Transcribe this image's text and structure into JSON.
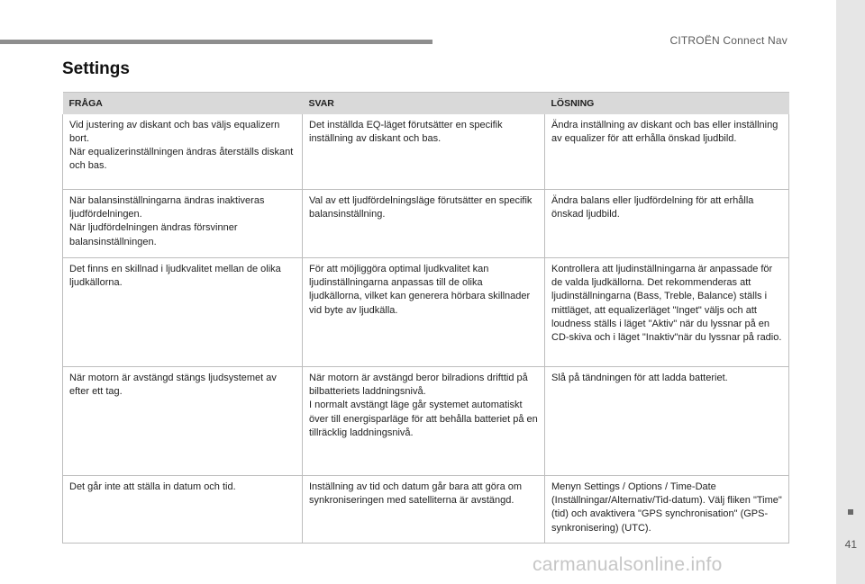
{
  "header": {
    "brand": "CITROËN Connect Nav"
  },
  "title": "Settings",
  "table": {
    "headers": [
      "FRÅGA",
      "SVAR",
      "LÖSNING"
    ],
    "rows": [
      {
        "question": "Vid justering av diskant och bas väljs equalizern bort.\nNär equalizerinställningen ändras återställs diskant och bas.",
        "answer": "Det inställda EQ-läget förutsätter en specifik inställning av diskant och bas.",
        "solution": "Ändra inställning av diskant och bas eller inställning av equalizer för att erhålla önskad ljudbild."
      },
      {
        "question": "När balansinställningarna ändras inaktiveras ljudfördelningen.\nNär ljudfördelningen ändras försvinner balansinställningen.",
        "answer": "Val av ett ljudfördelningsläge förutsätter en specifik balansinställning.",
        "solution": "Ändra balans eller ljudfördelning för att erhålla önskad ljudbild."
      },
      {
        "question": "Det finns en skillnad i ljudkvalitet mellan de olika ljudkällorna.",
        "answer": "För att möjliggöra optimal ljudkvalitet kan ljudinställningarna anpassas till de olika ljudkällorna, vilket kan generera hörbara skillnader vid byte av ljudkälla.",
        "solution": "Kontrollera att ljudinställningarna är anpassade för de valda ljudkällorna. Det rekommenderas att ljudinställningarna (Bass, Treble, Balance) ställs i mittläget, att equalizerläget \"Inget\" väljs och att loudness ställs i läget \"Aktiv\" när du lyssnar på en CD-skiva och i läget \"Inaktiv\"när du lyssnar på radio."
      },
      {
        "question": "När motorn är avstängd stängs ljudsystemet av efter ett tag.",
        "answer": "När motorn är avstängd beror bilradions drifttid på bilbatteriets laddningsnivå.\nI normalt avstängt läge går systemet automatiskt över till energisparläge för att behålla batteriet på en tillräcklig laddningsnivå.",
        "solution": "Slå på tändningen för att ladda batteriet."
      },
      {
        "question": "Det går inte att ställa in datum och tid.",
        "answer": "Inställning av tid och datum går bara att göra om synkroniseringen med satelliterna är avstängd.",
        "solution": "Menyn Settings / Options / Time-Date (Inställningar/Alternativ/Tid-datum). Välj fliken \"Time\" (tid) och avaktivera \"GPS synchronisation\" (GPS-synkronisering) (UTC)."
      }
    ]
  },
  "page_number": "41",
  "watermark": "carmanualsonline.info"
}
